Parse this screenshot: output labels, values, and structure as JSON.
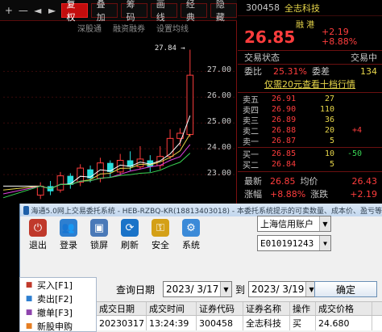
{
  "chart_toolbar": {
    "plus_icon": "+",
    "minus_icon": "—",
    "prev_icon": "◄",
    "next_icon": "►",
    "buttons": [
      {
        "label": "复权",
        "active": true
      },
      {
        "label": "叠加",
        "active": false
      },
      {
        "label": "筹码",
        "active": false
      },
      {
        "label": "画线",
        "active": false
      },
      {
        "label": "经典",
        "active": false
      },
      {
        "label": "隐藏",
        "active": false
      }
    ],
    "sub_links": [
      "深股通",
      "融资融券",
      "设置均线"
    ]
  },
  "chart_data": {
    "type": "candlestick",
    "y_ticks": [
      27.0,
      26.0,
      25.0,
      24.0,
      23.0
    ],
    "peak_label": "27.84",
    "candles": [
      {
        "o": 22.2,
        "c": 22.55,
        "h": 22.7,
        "l": 22.05
      },
      {
        "o": 22.55,
        "c": 22.35,
        "h": 22.75,
        "l": 22.2
      },
      {
        "o": 22.4,
        "c": 22.95,
        "h": 23.1,
        "l": 22.3
      },
      {
        "o": 22.95,
        "c": 22.6,
        "h": 23.05,
        "l": 22.45
      },
      {
        "o": 22.7,
        "c": 23.25,
        "h": 23.4,
        "l": 22.55
      },
      {
        "o": 23.2,
        "c": 22.85,
        "h": 23.35,
        "l": 22.7
      },
      {
        "o": 22.85,
        "c": 23.45,
        "h": 23.65,
        "l": 22.7
      },
      {
        "o": 23.45,
        "c": 23.1,
        "h": 23.55,
        "l": 22.9
      },
      {
        "o": 23.1,
        "c": 23.55,
        "h": 23.8,
        "l": 22.95
      },
      {
        "o": 23.55,
        "c": 23.3,
        "h": 23.9,
        "l": 23.15
      },
      {
        "o": 23.3,
        "c": 23.6,
        "h": 24.1,
        "l": 23.2
      },
      {
        "o": 23.55,
        "c": 23.3,
        "h": 23.75,
        "l": 23.1
      },
      {
        "o": 23.35,
        "c": 23.7,
        "h": 24.1,
        "l": 23.2
      },
      {
        "o": 23.7,
        "c": 24.4,
        "h": 24.75,
        "l": 23.6
      },
      {
        "o": 24.4,
        "c": 24.6,
        "h": 24.8,
        "l": 24.1
      },
      {
        "o": 24.55,
        "c": 26.85,
        "h": 27.84,
        "l": 24.45
      }
    ],
    "ma_colors": [
      "#ffffff",
      "#e7d64a",
      "#e040e0",
      "#39d353"
    ],
    "ylim": [
      22.0,
      28.2
    ]
  },
  "quote": {
    "code": "300458",
    "name": "全志科技",
    "mark": "融 港",
    "price": "26.85",
    "change": "+2.19",
    "change_pct": "+8.88%",
    "status_label": "交易状态",
    "status_value": "交易中",
    "ratio_label": "委比",
    "ratio_value": "25.31%",
    "diff_label": "委差",
    "diff_value": "134",
    "promo": "仅需20元查看十档行情",
    "asks": [
      {
        "name": "卖五",
        "price": "26.91",
        "vol": "27",
        "delta": ""
      },
      {
        "name": "卖四",
        "price": "26.90",
        "vol": "110",
        "delta": ""
      },
      {
        "name": "卖三",
        "price": "26.89",
        "vol": "36",
        "delta": ""
      },
      {
        "name": "卖二",
        "price": "26.88",
        "vol": "20",
        "delta": "+4"
      },
      {
        "name": "卖一",
        "price": "26.87",
        "vol": "5",
        "delta": ""
      }
    ],
    "bids": [
      {
        "name": "买一",
        "price": "26.85",
        "vol": "10",
        "delta": "-50"
      },
      {
        "name": "买二",
        "price": "26.84",
        "vol": "5",
        "delta": ""
      },
      {
        "name": "买三",
        "price": "26.83",
        "vol": "8",
        "delta": "+3"
      },
      {
        "name": "买四",
        "price": "26.82",
        "vol": "19",
        "delta": ""
      },
      {
        "name": "买五",
        "price": "26.81",
        "vol": "17",
        "delta": ""
      }
    ],
    "latest_label": "最新",
    "latest_value": "26.85",
    "avg_label": "均价",
    "avg_value": "26.43",
    "pct_label": "涨幅",
    "pct_value": "+8.88%",
    "chg_label": "涨跌",
    "chg_value": "+2.19"
  },
  "trade_window": {
    "title": "海通5.0网上交易委托系统 - HEB-RZBQ-KR(18813403018) - 本委托系统提示的可卖数量、成本价、盈亏等",
    "tools": [
      {
        "label": "退出",
        "icon": "exit-icon",
        "color": "#c0392b",
        "glyph": "⏻"
      },
      {
        "label": "登录",
        "icon": "users-icon",
        "color": "#2e7fd0",
        "glyph": "👥"
      },
      {
        "label": "锁屏",
        "icon": "lock-screen-icon",
        "color": "#4a79b8",
        "glyph": "▣"
      },
      {
        "label": "刷新",
        "icon": "refresh-icon",
        "color": "#1a73c8",
        "glyph": "⟳"
      },
      {
        "label": "安全",
        "icon": "security-icon",
        "color": "#d4a017",
        "glyph": "⚿"
      },
      {
        "label": "系统",
        "icon": "system-icon",
        "color": "#3b8ad8",
        "glyph": "⚙"
      }
    ],
    "account_type": "上海信用账户",
    "account_no": "E010191243",
    "menu": [
      {
        "label": "买入[F1]",
        "icon": "buy-icon"
      },
      {
        "label": "卖出[F2]",
        "icon": "sell-icon"
      },
      {
        "label": "撤单[F3]",
        "icon": "cancel-order-icon"
      },
      {
        "label": "新股申购",
        "icon": "ipo-icon"
      }
    ],
    "query": {
      "date_label": "查询日期",
      "start_date": "2023/ 3/17",
      "to_label": "到",
      "end_date": "2023/ 3/19",
      "confirm": "确定"
    },
    "table": {
      "headers": [
        "成交日期",
        "成交时间",
        "证券代码",
        "证券名称",
        "操作",
        "成交价格"
      ],
      "rows": [
        [
          "20230317",
          "13:24:39",
          "300458",
          "全志科技",
          "买",
          "24.680"
        ]
      ]
    }
  }
}
